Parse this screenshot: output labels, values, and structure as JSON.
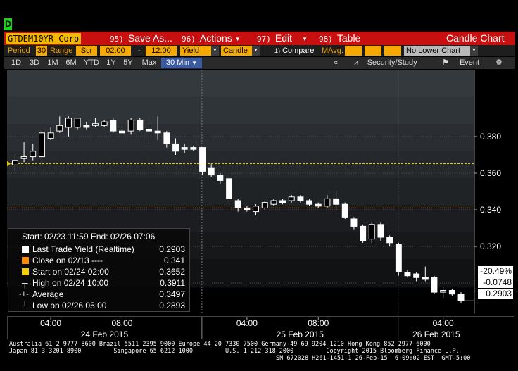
{
  "marker": "D",
  "toolbar1": {
    "ticker": "GTDEM10YR Corp",
    "save": {
      "num": "95)",
      "label": "Save As..."
    },
    "actions": {
      "num": "96)",
      "label": "Actions"
    },
    "edit": {
      "num": "97)",
      "label": "Edit"
    },
    "table": {
      "num": "98)",
      "label": "Table"
    },
    "title": "Candle Chart"
  },
  "toolbar2": {
    "period_label": "Period",
    "period_value": "30",
    "range_label": "Range",
    "range_value": "Scr",
    "time_from": "02:00",
    "dash": "-",
    "time_to": "12:00",
    "field": "Yield",
    "style": "Candle",
    "compare_num": "1)",
    "compare": "Compare",
    "mavg": "MAvg.",
    "lower": "No Lower Chart"
  },
  "toolbar3": {
    "periods": [
      "1D",
      "3D",
      "1M",
      "6M",
      "YTD",
      "1Y",
      "5Y",
      "Max"
    ],
    "active_period": "30 Min",
    "collapse": "«",
    "security": "Security/Study",
    "event": "Event"
  },
  "chart_data": {
    "type": "candlestick",
    "y_ticks": [
      "0.380",
      "0.360",
      "0.340",
      "0.320"
    ],
    "y_tick_values": [
      0.38,
      0.36,
      0.34,
      0.32
    ],
    "ylim": [
      0.2835,
      0.4165
    ],
    "start_value": 0.3652,
    "x_ticks": [
      "04:00",
      "08:00",
      "04:00",
      "08:00",
      "04:00"
    ],
    "days": [
      "24 Feb 2015",
      "25 Feb 2015",
      "26 Feb 2015"
    ],
    "candles": [
      {
        "o": 0.3645,
        "h": 0.369,
        "l": 0.361,
        "c": 0.367
      },
      {
        "o": 0.368,
        "h": 0.377,
        "l": 0.366,
        "c": 0.369
      },
      {
        "o": 0.369,
        "h": 0.376,
        "l": 0.367,
        "c": 0.372
      },
      {
        "o": 0.369,
        "h": 0.383,
        "l": 0.368,
        "c": 0.382
      },
      {
        "o": 0.379,
        "h": 0.385,
        "l": 0.378,
        "c": 0.382
      },
      {
        "o": 0.383,
        "h": 0.391,
        "l": 0.382,
        "c": 0.386
      },
      {
        "o": 0.385,
        "h": 0.391,
        "l": 0.38,
        "c": 0.39
      },
      {
        "o": 0.385,
        "h": 0.39,
        "l": 0.384,
        "c": 0.39
      },
      {
        "o": 0.386,
        "h": 0.388,
        "l": 0.384,
        "c": 0.385
      },
      {
        "o": 0.386,
        "h": 0.39,
        "l": 0.385,
        "c": 0.387
      },
      {
        "o": 0.386,
        "h": 0.389,
        "l": 0.385,
        "c": 0.388
      },
      {
        "o": 0.389,
        "h": 0.39,
        "l": 0.382,
        "c": 0.383
      },
      {
        "o": 0.383,
        "h": 0.385,
        "l": 0.381,
        "c": 0.382
      },
      {
        "o": 0.383,
        "h": 0.39,
        "l": 0.381,
        "c": 0.389
      },
      {
        "o": 0.389,
        "h": 0.39,
        "l": 0.383,
        "c": 0.384
      },
      {
        "o": 0.384,
        "h": 0.387,
        "l": 0.377,
        "c": 0.383
      },
      {
        "o": 0.383,
        "h": 0.391,
        "l": 0.378,
        "c": 0.382
      },
      {
        "o": 0.382,
        "h": 0.383,
        "l": 0.374,
        "c": 0.376
      },
      {
        "o": 0.376,
        "h": 0.379,
        "l": 0.37,
        "c": 0.372
      },
      {
        "o": 0.374,
        "h": 0.376,
        "l": 0.371,
        "c": 0.373
      },
      {
        "o": 0.374,
        "h": 0.375,
        "l": 0.372,
        "c": 0.373
      },
      {
        "o": 0.374,
        "h": 0.374,
        "l": 0.359,
        "c": 0.361
      },
      {
        "o": 0.363,
        "h": 0.365,
        "l": 0.358,
        "c": 0.359
      },
      {
        "o": 0.359,
        "h": 0.36,
        "l": 0.354,
        "c": 0.356
      },
      {
        "o": 0.357,
        "h": 0.358,
        "l": 0.345,
        "c": 0.346
      },
      {
        "o": 0.345,
        "h": 0.346,
        "l": 0.339,
        "c": 0.341
      },
      {
        "o": 0.341,
        "h": 0.342,
        "l": 0.339,
        "c": 0.34
      },
      {
        "o": 0.339,
        "h": 0.343,
        "l": 0.337,
        "c": 0.342
      },
      {
        "o": 0.341,
        "h": 0.345,
        "l": 0.34,
        "c": 0.344
      },
      {
        "o": 0.343,
        "h": 0.346,
        "l": 0.342,
        "c": 0.345
      },
      {
        "o": 0.345,
        "h": 0.346,
        "l": 0.343,
        "c": 0.344
      },
      {
        "o": 0.345,
        "h": 0.348,
        "l": 0.344,
        "c": 0.347
      },
      {
        "o": 0.347,
        "h": 0.348,
        "l": 0.344,
        "c": 0.345
      },
      {
        "o": 0.345,
        "h": 0.346,
        "l": 0.342,
        "c": 0.343
      },
      {
        "o": 0.343,
        "h": 0.344,
        "l": 0.341,
        "c": 0.342
      },
      {
        "o": 0.342,
        "h": 0.348,
        "l": 0.341,
        "c": 0.346
      },
      {
        "o": 0.346,
        "h": 0.35,
        "l": 0.34,
        "c": 0.343
      },
      {
        "o": 0.343,
        "h": 0.344,
        "l": 0.335,
        "c": 0.336
      },
      {
        "o": 0.335,
        "h": 0.336,
        "l": 0.329,
        "c": 0.331
      },
      {
        "o": 0.331,
        "h": 0.332,
        "l": 0.322,
        "c": 0.323
      },
      {
        "o": 0.324,
        "h": 0.333,
        "l": 0.322,
        "c": 0.332
      },
      {
        "o": 0.332,
        "h": 0.333,
        "l": 0.323,
        "c": 0.325
      },
      {
        "o": 0.325,
        "h": 0.326,
        "l": 0.32,
        "c": 0.322
      },
      {
        "o": 0.321,
        "h": 0.322,
        "l": 0.304,
        "c": 0.306
      },
      {
        "o": 0.306,
        "h": 0.307,
        "l": 0.303,
        "c": 0.304
      },
      {
        "o": 0.305,
        "h": 0.306,
        "l": 0.301,
        "c": 0.303
      },
      {
        "o": 0.303,
        "h": 0.309,
        "l": 0.301,
        "c": 0.302
      },
      {
        "o": 0.303,
        "h": 0.304,
        "l": 0.294,
        "c": 0.295
      },
      {
        "o": 0.295,
        "h": 0.298,
        "l": 0.292,
        "c": 0.296
      },
      {
        "o": 0.296,
        "h": 0.297,
        "l": 0.293,
        "c": 0.294
      },
      {
        "o": 0.294,
        "h": 0.295,
        "l": 0.2893,
        "c": 0.2903
      }
    ]
  },
  "legend": {
    "header": "Start: 02/23 11:59  End: 02/26 07:06",
    "rows": [
      {
        "label": "Last Trade Yield (Realtime)",
        "value": "0.2903",
        "color": "#ffffff"
      },
      {
        "label": "Close on 02/13 ----",
        "value": "0.341",
        "color": "#ff8c00"
      },
      {
        "label": "Start on 02/24 02:00",
        "value": "0.3652",
        "color": "#f5d000"
      },
      {
        "label": "High on 02/24 10:00",
        "value": "0.3911",
        "color": "#ffffff"
      },
      {
        "label": "Average",
        "value": "0.3497",
        "color": "#ffffff"
      },
      {
        "label": "Low on 02/26 05:00",
        "value": "0.2893",
        "color": "#ffffff"
      }
    ]
  },
  "right_boxes": {
    "pct": "-20.49%",
    "chg": "-0.0748",
    "last": "0.2903"
  },
  "footer": {
    "line1": "Australia 61 2 9777 8600 Brazil 5511 2395 9000 Europe 44 20 7330 7500 Germany 49 69 9204 1210 Hong Kong 852 2977 6000",
    "line2": "Japan 81 3 3201 8900         Singapore 65 6212 1000         U.S. 1 212 318 2000         Copyright 2015 Bloomberg Finance L.P.",
    "line3": "SN 672028 H261-1451-1 26-Feb-15  6:09:02 EST  GMT-5:00"
  }
}
